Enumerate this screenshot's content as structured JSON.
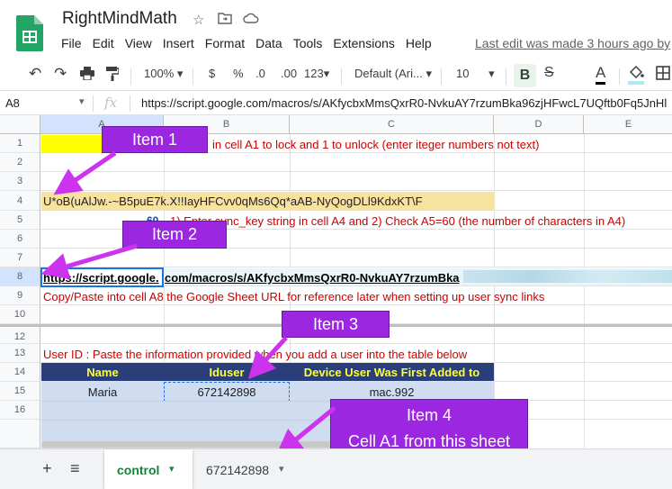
{
  "app": {
    "title": "RightMindMath",
    "menu": [
      "File",
      "Edit",
      "View",
      "Insert",
      "Format",
      "Data",
      "Tools",
      "Extensions",
      "Help"
    ],
    "last_edit": "Last edit was made 3 hours ago by"
  },
  "toolbar": {
    "zoom": "100%",
    "currency": "$",
    "percent": "%",
    "dec_less": ".0",
    "dec_more": ".00",
    "more_formats": "123",
    "font": "Default (Ari...",
    "font_size": "10",
    "bold": "B"
  },
  "formula_bar": {
    "cell_ref": "A8",
    "fx": "fx",
    "value": "https://script.google.com/macros/s/AKfycbxMmsQxrR0-NvkuAY7rzumBka96zjHFwcL7UQftb0Fq5JnHl"
  },
  "columns": [
    "A",
    "B",
    "C",
    "D",
    "E"
  ],
  "rows": [
    "1",
    "2",
    "3",
    "4",
    "5",
    "6",
    "7",
    "8",
    "9",
    "10",
    "12",
    "13",
    "14",
    "15",
    "16"
  ],
  "cells": {
    "r1_text": "in cell A1 to lock and 1 to unlock (enter iteger numbers not text)",
    "r4_text": "U*oB(uAlJw.-~B5puE7k.X!!IayHFCvv0qMs6Qq*aAB-NyQogDLl9KdxKT\\F",
    "r5_num": "60",
    "r5_text": "1) Enter sync_key string in cell A4  and  2) Check A5=60 (the number of characters in A4)",
    "r8_link_a": "https://script.google.",
    "r8_link_b": "com/macros/s/AKfycbxMmsQxrR0-NvkuAY7rzumBka",
    "r9_text": "Copy/Paste into cell A8 the Google Sheet URL for reference later when setting up user sync links",
    "r12_text": "User ID : Paste the information provided when you add a user into the table below",
    "table_headers": [
      "Name",
      "Iduser",
      "Device User Was First Added to"
    ],
    "table_row": [
      "Maria",
      "672142898",
      "mac.992"
    ]
  },
  "callouts": {
    "item1": "Item 1",
    "item2": "Item 2",
    "item3": "Item 3",
    "item4": "Item 4",
    "item4_sub": "Cell A1 from this sheet"
  },
  "tabs": {
    "add": "+",
    "all": "≡",
    "tab1": "control",
    "tab2": "672142898"
  },
  "colors": {
    "callout": "#9b27e0",
    "header_bg": "#2a3f7a",
    "header_text": "#ffff33",
    "table_fill": "#d0dcef",
    "yellow": "#ffff00",
    "tan": "#f8e2a0",
    "red_text": "#cc0000",
    "tab_active": "#188038"
  }
}
